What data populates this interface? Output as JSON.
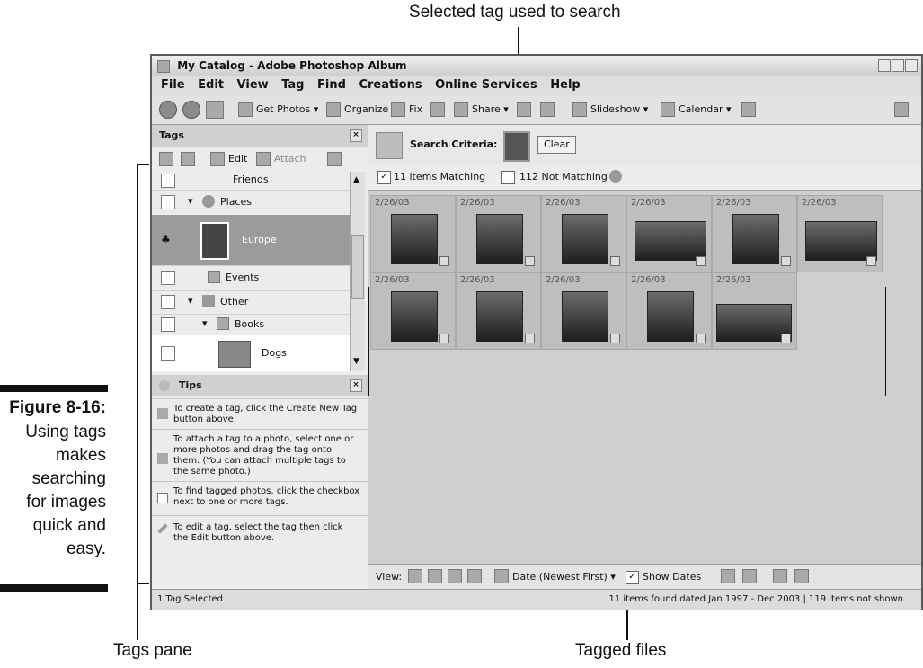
{
  "callouts": {
    "top": "Selected tag used to search",
    "tags_pane": "Tags pane",
    "tagged_files": "Tagged files"
  },
  "figure": {
    "label": "Figure 8-16:",
    "lines": [
      "Using tags",
      "makes",
      "searching",
      "for images",
      "quick and",
      "easy."
    ]
  },
  "window": {
    "title": "My Catalog - Adobe Photoshop Album",
    "menu": [
      "File",
      "Edit",
      "View",
      "Tag",
      "Find",
      "Creations",
      "Online Services",
      "Help"
    ]
  },
  "toolbar": {
    "get_photos": "Get Photos",
    "organize": "Organize",
    "fix": "Fix",
    "share": "Share",
    "slideshow": "Slideshow",
    "calendar": "Calendar"
  },
  "tags_pane": {
    "title": "Tags",
    "edit": "Edit",
    "attach": "Attach",
    "items": [
      "Friends",
      "Places",
      "Europe",
      "Events",
      "Other",
      "Books",
      "Dogs"
    ]
  },
  "tips": {
    "title": "Tips",
    "items": [
      "To create a tag, click the Create New Tag button above.",
      "To attach a tag to a photo, select one or more photos and drag the tag onto them. (You can attach multiple tags to the same photo.)",
      "To find tagged photos, click the checkbox next to one or more tags.",
      "To edit a tag, select the tag then click the Edit button above."
    ]
  },
  "search": {
    "label": "Search Criteria:",
    "clear": "Clear",
    "matching": "11 items Matching",
    "not_matching": "112 Not Matching"
  },
  "photos": {
    "dates": [
      "2/26/03",
      "2/26/03",
      "2/26/03",
      "2/26/03",
      "2/26/03",
      "2/26/03",
      "2/26/03",
      "2/26/03",
      "2/26/03",
      "2/26/03",
      "2/26/03"
    ]
  },
  "view_bar": {
    "view_label": "View:",
    "sort": "Date (Newest First)",
    "show_dates": "Show Dates"
  },
  "status": {
    "left": "1 Tag Selected",
    "right": "11 items found dated Jan 1997 - Dec 2003  |  119 items not shown"
  }
}
